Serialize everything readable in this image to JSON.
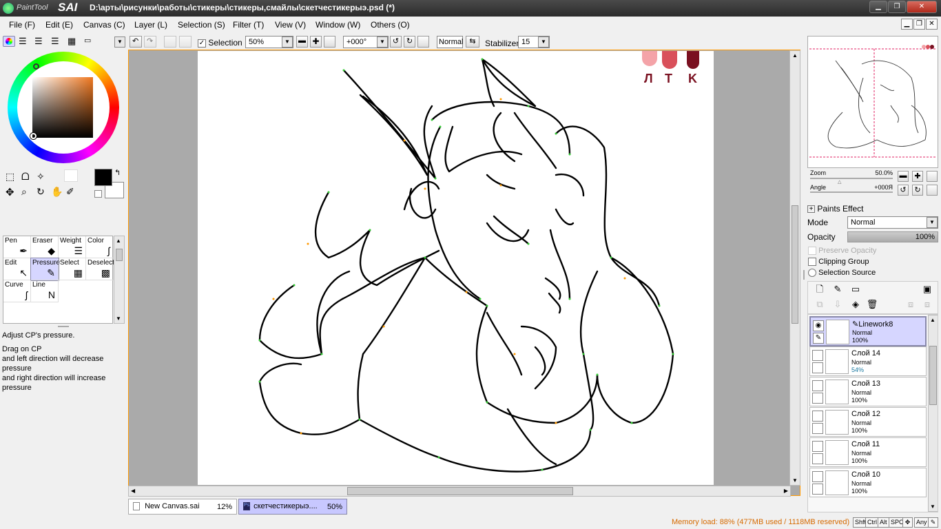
{
  "app": {
    "title": "D:\\арты\\рисунки\\работы\\стикеры\\стикеры,смайлы\\скетчестикерыэ.psd (*)",
    "logo_small": "PaintTool",
    "logo_big": "SAI"
  },
  "menu": [
    "File (F)",
    "Edit (E)",
    "Canvas (C)",
    "Layer (L)",
    "Selection (S)",
    "Filter (T)",
    "View (V)",
    "Window (W)",
    "Others (O)"
  ],
  "toolbar": {
    "selection_label": "Selection",
    "zoom": "50%",
    "angle": "+000°",
    "blend": "Normal",
    "stabilizer_label": "Stabilizer",
    "stabilizer_value": "15"
  },
  "tools": [
    {
      "label": "Pen",
      "icon": "pen-icon",
      "glyph": "✒"
    },
    {
      "label": "Eraser",
      "icon": "eraser-icon",
      "glyph": "◆"
    },
    {
      "label": "Weight",
      "icon": "weight-icon",
      "glyph": "☰"
    },
    {
      "label": "Color",
      "icon": "color-curve-icon",
      "glyph": "∫"
    },
    {
      "label": "Edit",
      "icon": "edit-cursor-icon",
      "glyph": "↖"
    },
    {
      "label": "Pressure",
      "icon": "pressure-icon",
      "glyph": "✎"
    },
    {
      "label": "Select",
      "icon": "select-icon",
      "glyph": "▦"
    },
    {
      "label": "Deselect",
      "icon": "deselect-icon",
      "glyph": "▩"
    },
    {
      "label": "Curve",
      "icon": "curve-icon",
      "glyph": "ʃ"
    },
    {
      "label": "Line",
      "icon": "line-icon",
      "glyph": "N"
    }
  ],
  "tool_help": {
    "title": "Adjust CP's pressure.",
    "line1": "Drag on CP",
    "line2": "and left direction will decrease pressure",
    "line3": "and right direction will increase pressure"
  },
  "canvas": {
    "palette_labels": [
      "Л",
      "T",
      "K"
    ]
  },
  "tabs": [
    {
      "name": "New Canvas.sai",
      "zoom": "12%"
    },
    {
      "name": "скетчестикерыэ....",
      "zoom": "50%"
    }
  ],
  "status": {
    "memory": "Memory load: 88% (477MB used / 1118MB reserved)",
    "keys": [
      "Shft",
      "Ctrl",
      "Alt",
      "SPC",
      "Any"
    ]
  },
  "navigator": {
    "zoom_label": "Zoom",
    "zoom_value": "50.0%",
    "angle_label": "Angle",
    "angle_value": "+000Я"
  },
  "layer_props": {
    "paints_effect": "Paints Effect",
    "mode_label": "Mode",
    "mode_value": "Normal",
    "opacity_label": "Opacity",
    "opacity_value": "100%",
    "preserve_opacity": "Preserve Opacity",
    "clipping_group": "Clipping Group",
    "selection_source": "Selection Source"
  },
  "layers": [
    {
      "name": "Linework8",
      "mode": "Normal",
      "opacity": "100%"
    },
    {
      "name": "Слой 14",
      "mode": "Normal",
      "opacity": "54%"
    },
    {
      "name": "Слой 13",
      "mode": "Normal",
      "opacity": "100%"
    },
    {
      "name": "Слой 12",
      "mode": "Normal",
      "opacity": "100%"
    },
    {
      "name": "Слой 11",
      "mode": "Normal",
      "opacity": "100%"
    },
    {
      "name": "Слой 10",
      "mode": "Normal",
      "opacity": "100%"
    }
  ],
  "colors": {
    "accent": "#d6d6ff",
    "canvas_border": "#ff9900",
    "status_text": "#d66a00",
    "palette": [
      "#f4a3a8",
      "#d9505a",
      "#7a1020"
    ]
  }
}
